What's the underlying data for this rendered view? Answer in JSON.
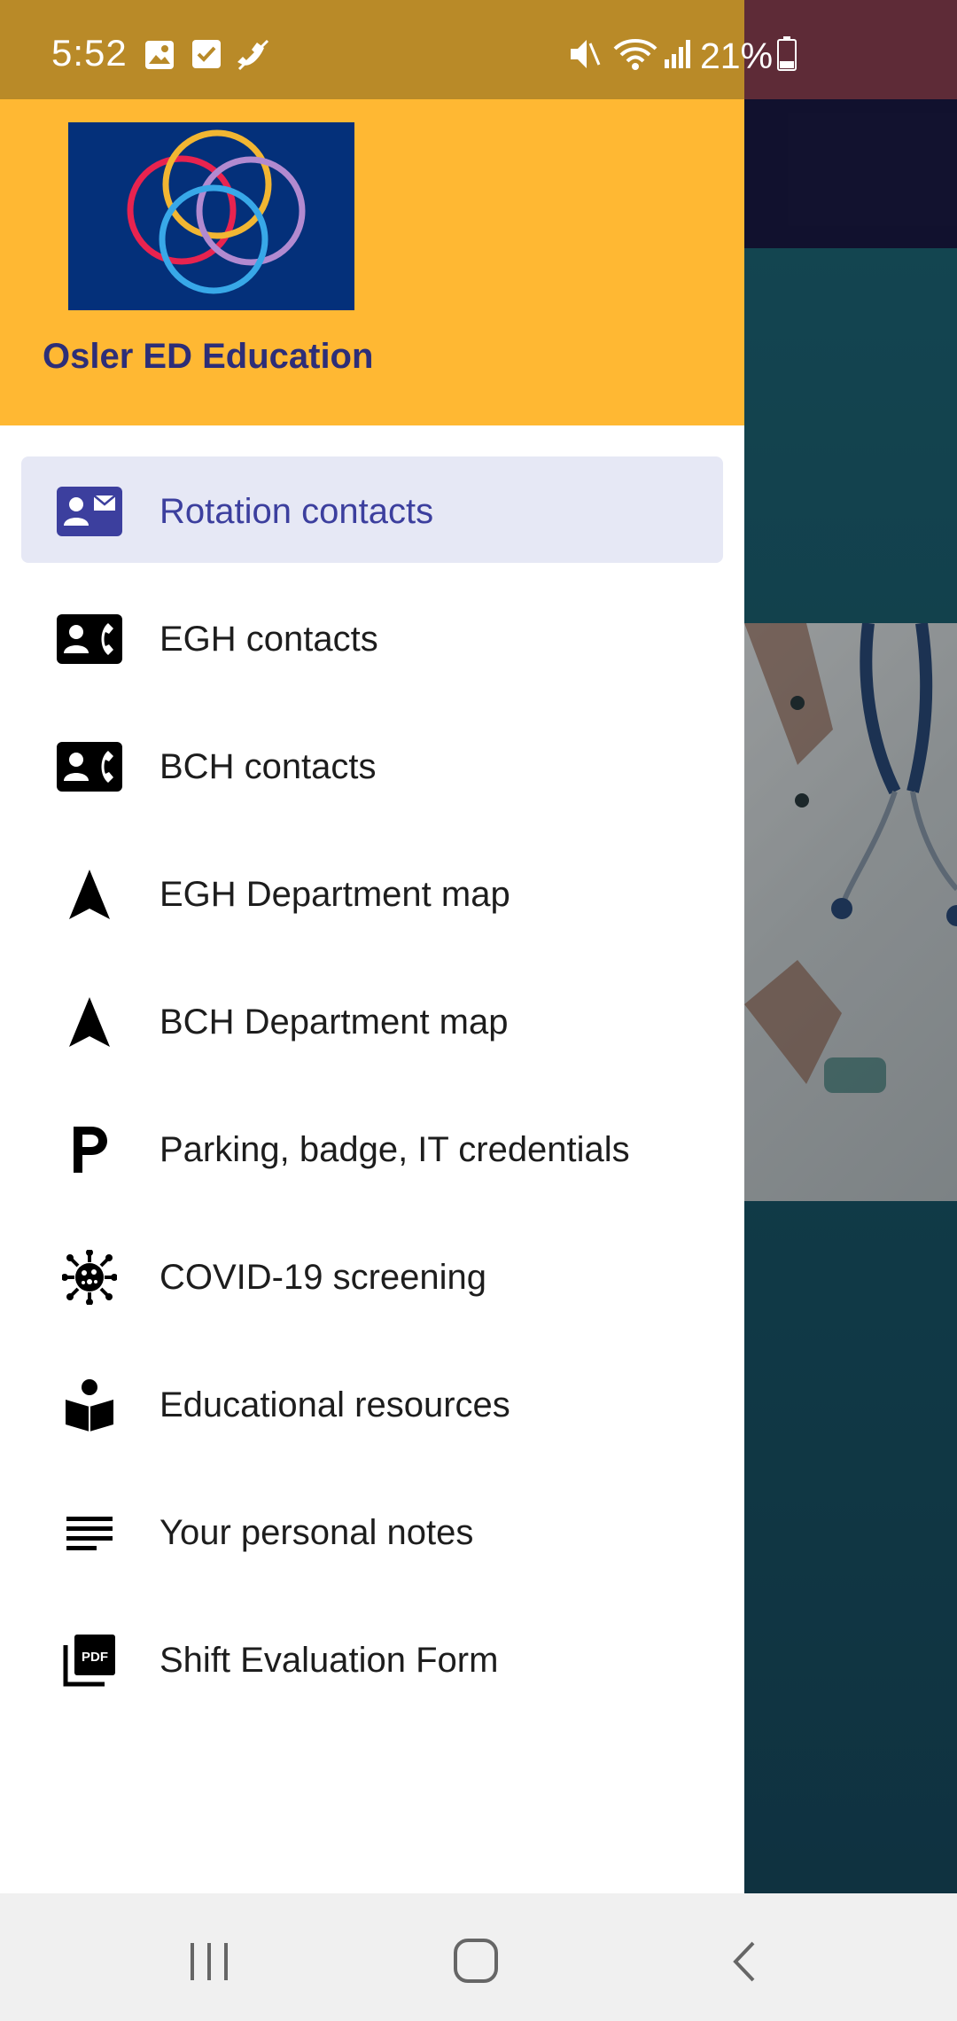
{
  "status_bar": {
    "time": "5:52",
    "battery": "21%"
  },
  "app": {
    "title": "Osler ED Education",
    "logo_icon": "interlocking-rings-logo"
  },
  "menu": {
    "items": [
      {
        "label": "Rotation contacts",
        "icon": "contact-mail-icon",
        "active": true
      },
      {
        "label": "EGH contacts",
        "icon": "contact-phone-icon"
      },
      {
        "label": "BCH contacts",
        "icon": "contact-phone-icon"
      },
      {
        "label": "EGH Department map",
        "icon": "navigation-arrow-icon"
      },
      {
        "label": "BCH Department map",
        "icon": "navigation-arrow-icon"
      },
      {
        "label": "Parking, badge, IT credentials",
        "icon": "parking-icon"
      },
      {
        "label": "COVID-19 screening",
        "icon": "virus-icon"
      },
      {
        "label": "Educational resources",
        "icon": "reading-icon"
      },
      {
        "label": "Your personal notes",
        "icon": "notes-icon"
      },
      {
        "label": "Shift Evaluation Form",
        "icon": "pdf-icon"
      }
    ]
  },
  "colors": {
    "drawer_header": "#ffb833",
    "title_text": "#2d2e78",
    "active_item_bg": "#e6e8f5",
    "active_item_text": "#3c3f9e"
  }
}
